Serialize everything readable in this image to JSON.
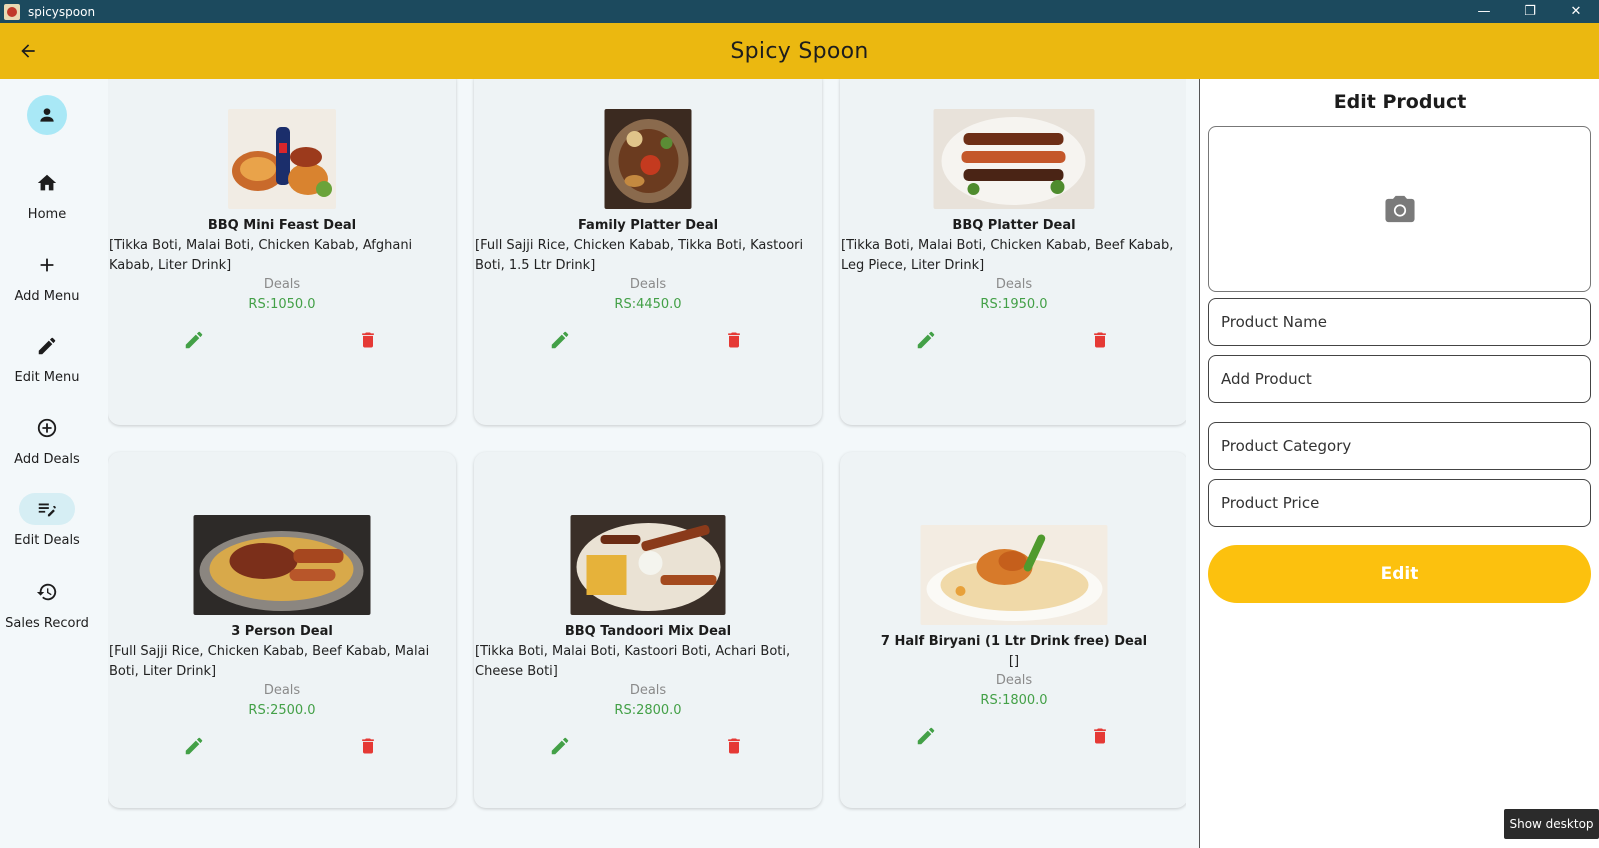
{
  "window": {
    "title": "spicyspoon",
    "buttons": [
      "—",
      "❐",
      "✕"
    ]
  },
  "appbar": {
    "title": "Spicy Spoon"
  },
  "rail": {
    "items": [
      {
        "label": "Home",
        "icon": "home-icon"
      },
      {
        "label": "Add Menu",
        "icon": "add-icon"
      },
      {
        "label": "Edit Menu",
        "icon": "pencil-icon"
      },
      {
        "label": "Add Deals",
        "icon": "add-circle-icon"
      },
      {
        "label": "Edit Deals",
        "icon": "edit-note-icon",
        "active": true
      },
      {
        "label": "Sales Record",
        "icon": "history-icon"
      }
    ]
  },
  "deals": [
    {
      "name": "BBQ Mini Feast Deal",
      "desc": "[Tikka Boti, Malai Boti, Chicken Kabab, Afghani Kabab, Liter Drink]",
      "category": "Deals",
      "price": "RS:1050.0"
    },
    {
      "name": "Family Platter Deal",
      "desc": "[Full Sajji Rice, Chicken Kabab, Tikka Boti, Kastoori Boti, 1.5 Ltr Drink]",
      "category": "Deals",
      "price": "RS:4450.0"
    },
    {
      "name": "BBQ Platter Deal",
      "desc": "[Tikka Boti, Malai Boti, Chicken Kabab, Beef Kabab, Leg Piece, Liter Drink]",
      "category": "Deals",
      "price": "RS:1950.0"
    },
    {
      "name": "3 Person Deal",
      "desc": "[Full Sajji Rice, Chicken Kabab, Beef Kabab, Malai Boti, Liter Drink]",
      "category": "Deals",
      "price": "RS:2500.0"
    },
    {
      "name": "BBQ Tandoori Mix Deal",
      "desc": "[Tikka Boti, Malai Boti, Kastoori Boti, Achari Boti, Cheese Boti]",
      "category": "Deals",
      "price": "RS:2800.0"
    },
    {
      "name": "7 Half Biryani (1 Ltr Drink free) Deal",
      "desc": "[]",
      "category": "Deals",
      "price": "RS:1800.0"
    }
  ],
  "panel": {
    "title": "Edit Product",
    "fields": {
      "name_placeholder": "Product Name",
      "product_placeholder": "Add Product",
      "category_placeholder": "Product Category",
      "price_placeholder": "Product Price"
    },
    "button": "Edit"
  },
  "taskbar": {
    "show_desktop": "Show desktop"
  },
  "colors": {
    "appbar": "#ebb810",
    "titlebar": "#1c4a5e",
    "price": "#43a047",
    "edit_icon": "#43a047",
    "delete_icon": "#e53935",
    "edit_button": "#fcc10e"
  }
}
